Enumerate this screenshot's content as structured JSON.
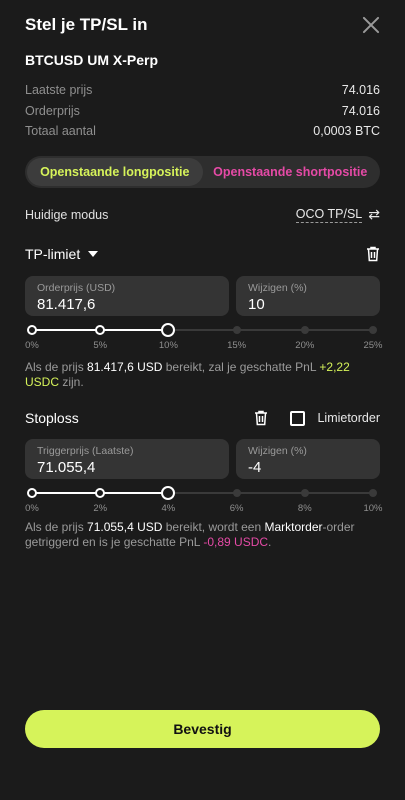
{
  "header": {
    "title": "Stel je TP/SL in"
  },
  "symbol": "BTCUSD UM X-Perp",
  "info": [
    {
      "label": "Laatste prijs",
      "value": "74.016"
    },
    {
      "label": "Orderprijs",
      "value": "74.016"
    },
    {
      "label": "Totaal aantal",
      "value": "0,0003 BTC"
    }
  ],
  "tabs": {
    "long": "Openstaande longpositie",
    "short": "Openstaande shortpositie"
  },
  "mode": {
    "label": "Huidige modus",
    "value": "OCO TP/SL"
  },
  "tp": {
    "title": "TP-limiet",
    "price_label": "Orderprijs (USD)",
    "price_value": "81.417,6",
    "change_label": "Wijzigen (%)",
    "change_value": "10",
    "slider_ticks": [
      "0%",
      "5%",
      "10%",
      "15%",
      "20%",
      "25%"
    ],
    "slider_value_percent": 10,
    "slider_max_percent": 25,
    "desc": {
      "pre": "Als de prijs ",
      "price": "81.417,6 USD",
      "mid": " bereikt, zal je geschatte PnL ",
      "pnl": "+2,22 USDC",
      "post": " zijn."
    }
  },
  "sl": {
    "title": "Stoploss",
    "limit_label": "Limietorder",
    "price_label": "Triggerprijs (Laatste)",
    "price_value": "71.055,4",
    "change_label": "Wijzigen (%)",
    "change_value": "-4",
    "slider_ticks": [
      "0%",
      "2%",
      "4%",
      "6%",
      "8%",
      "10%"
    ],
    "slider_value_percent": 4,
    "slider_max_percent": 10,
    "desc": {
      "pre": "Als de prijs ",
      "price": "71.055,4 USD",
      "mid": " bereikt, wordt een ",
      "order": "Marktorder",
      "mid2": "-order getriggerd en is je geschatte PnL ",
      "pnl": "-0,89 USDC",
      "post": "."
    }
  },
  "confirm_label": "Bevestig",
  "colors": {
    "accent_green": "#d6f35a",
    "accent_pink": "#e54aa6",
    "background": "#1b1b1b"
  }
}
